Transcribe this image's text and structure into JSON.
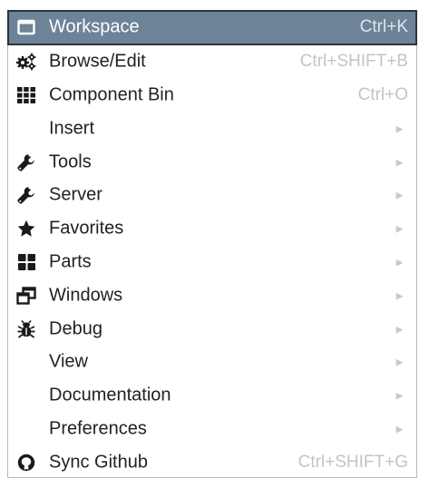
{
  "menu": {
    "items": [
      {
        "label": "Workspace",
        "shortcut": "Ctrl+K",
        "icon": "window-icon",
        "submenu": false
      },
      {
        "label": "Browse/Edit",
        "shortcut": "Ctrl+SHIFT+B",
        "icon": "gears-icon",
        "submenu": false
      },
      {
        "label": "Component Bin",
        "shortcut": "Ctrl+O",
        "icon": "grid-icon",
        "submenu": false
      },
      {
        "label": "Insert",
        "shortcut": "",
        "icon": "",
        "submenu": true
      },
      {
        "label": "Tools",
        "shortcut": "",
        "icon": "wrench-icon",
        "submenu": true
      },
      {
        "label": "Server",
        "shortcut": "",
        "icon": "wrench-icon",
        "submenu": true
      },
      {
        "label": "Favorites",
        "shortcut": "",
        "icon": "star-icon",
        "submenu": true
      },
      {
        "label": "Parts",
        "shortcut": "",
        "icon": "th-large-icon",
        "submenu": true
      },
      {
        "label": "Windows",
        "shortcut": "",
        "icon": "windows-restore-icon",
        "submenu": true
      },
      {
        "label": "Debug",
        "shortcut": "",
        "icon": "bug-icon",
        "submenu": true
      },
      {
        "label": "View",
        "shortcut": "",
        "icon": "",
        "submenu": true
      },
      {
        "label": "Documentation",
        "shortcut": "",
        "icon": "",
        "submenu": true
      },
      {
        "label": "Preferences",
        "shortcut": "",
        "icon": "",
        "submenu": true
      },
      {
        "label": "Sync Github",
        "shortcut": "Ctrl+SHIFT+G",
        "icon": "github-icon",
        "submenu": false
      }
    ],
    "submenu_arrow": "►",
    "colors": {
      "active_bg": "#6d8398",
      "active_border": "#2e3338",
      "shortcut_text": "#c4c4c4",
      "text": "#222222"
    }
  }
}
